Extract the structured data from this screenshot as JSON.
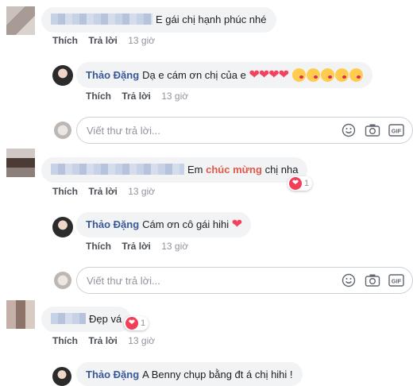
{
  "actions": {
    "like": "Thích",
    "reply": "Trả lời"
  },
  "reply_placeholder": "Viết thư trả lời...",
  "comments": [
    {
      "text": "E gái chị hạnh phúc nhé",
      "time": "13 giờ"
    },
    {
      "author": "Thảo Đặng",
      "text": "Dạ e cám ơn chị của e",
      "time": "13 giờ"
    },
    {
      "prefix": "Em",
      "highlight": "chúc mừng",
      "suffix": "chị nha",
      "reaction_count": "1",
      "time": "13 giờ"
    },
    {
      "author": "Thảo Đặng",
      "text": "Cám ơn cô gái hihi",
      "time": "13 giờ"
    },
    {
      "text": "Đẹp vá",
      "reaction_count": "1",
      "time": "13 giờ"
    },
    {
      "author": "Thảo Đặng",
      "text": "A Benny chụp bằng đt á chị hihi !"
    }
  ],
  "icons": [
    "emoji-icon",
    "camera-icon",
    "gif-icon",
    "heart-icon",
    "kiss-face-icon"
  ],
  "colors": {
    "link": "#385898",
    "heart": "#f3425f",
    "highlight": "#e4584b",
    "bubble": "#f2f3f5"
  }
}
